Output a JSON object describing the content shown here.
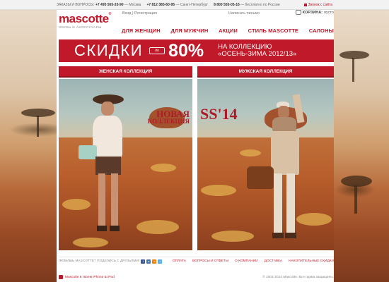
{
  "topbar": {
    "orders_label": "ЗАКАЗЫ И ВОПРОСЫ:",
    "phone_moscow": "+7 495 565-33-90",
    "city_moscow": "— Москва",
    "phone_spb": "+7 812 385-60-95",
    "city_spb": "— Санкт-Петербург",
    "phone_free": "8 800 555-05-16",
    "city_free": "— бесплатно по России",
    "callback": "Звонок с сайта"
  },
  "header": {
    "logo_word": "mascotte",
    "logo_reg": "®",
    "logo_tagline": "ОБУВЬ И АКСЕССУАРЫ",
    "login": "Вход",
    "separator": "|",
    "register": "Регистрация",
    "write_letter": "Написать письмо",
    "cart_label": "КОРЗИНА:",
    "cart_status": "пусто"
  },
  "nav": [
    "ДЛЯ ЖЕНЩИН",
    "ДЛЯ МУЖЧИН",
    "АКЦИИ",
    "СТИЛЬ MASCOTTE",
    "САЛОНЫ"
  ],
  "sale": {
    "word": "СКИДКИ",
    "upto": "до",
    "percent": "80%",
    "collection_line1": "НА КОЛЛЕКЦИЮ",
    "collection_line2": "«ОСЕНЬ-ЗИМА 2012/13»"
  },
  "collections": {
    "women_label": "ЖЕНСКАЯ КОЛЛЕКЦИЯ",
    "men_label": "МУЖСКАЯ КОЛЛЕКЦИЯ",
    "women_stamp_line1": "НОВАЯ",
    "women_stamp_line2": "КОЛЛЕКЦИЯ",
    "men_stamp": "SS'14"
  },
  "footer": {
    "share_text": "ЛЮБИШЬ MASCOTTE? ПОДЕЛИСЬ С ДРУЗЬЯМИ!",
    "links": [
      "ОПЛАТА",
      "ВОПРОСЫ И ОТВЕТЫ",
      "О КОМПАНИИ",
      "ДОСТАВКА",
      "НАКОПИТЕЛЬНЫЕ СКИДКИ"
    ],
    "app_text": "Mascotte в твоем iPhone & iPad",
    "copyright": "© 2001-2014 Mascotte. Все права защищены."
  },
  "colors": {
    "brand_red": "#c0192a",
    "panel_bg": "#ffffff"
  },
  "icons": [
    "shopping-bag-icon",
    "phone-icon",
    "facebook-icon",
    "vkontakte-icon",
    "odnoklassniki-icon",
    "twitter-icon",
    "apple-icon"
  ]
}
